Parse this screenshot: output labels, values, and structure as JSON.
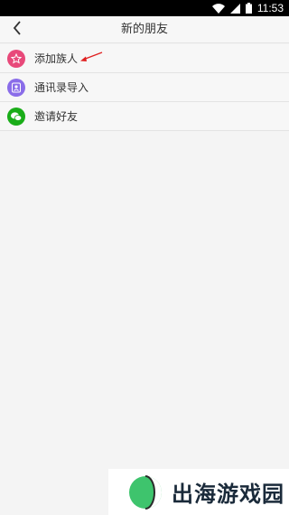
{
  "status_bar": {
    "time": "11:53",
    "icons": [
      "wifi-icon",
      "signal-icon",
      "battery-icon"
    ]
  },
  "nav": {
    "title": "新的朋友",
    "back_icon": "chevron-left-icon"
  },
  "items": [
    {
      "label": "添加族人",
      "icon": "star-person-icon",
      "color": "#e8497a"
    },
    {
      "label": "通讯录导入",
      "icon": "contacts-icon",
      "color": "#8a6de9"
    },
    {
      "label": "邀请好友",
      "icon": "wechat-icon",
      "color": "#1aad19"
    }
  ],
  "annotation": {
    "arrow_color": "#e02020"
  },
  "watermark": {
    "text": "出海游戏园",
    "color": "#1a2a3a"
  }
}
